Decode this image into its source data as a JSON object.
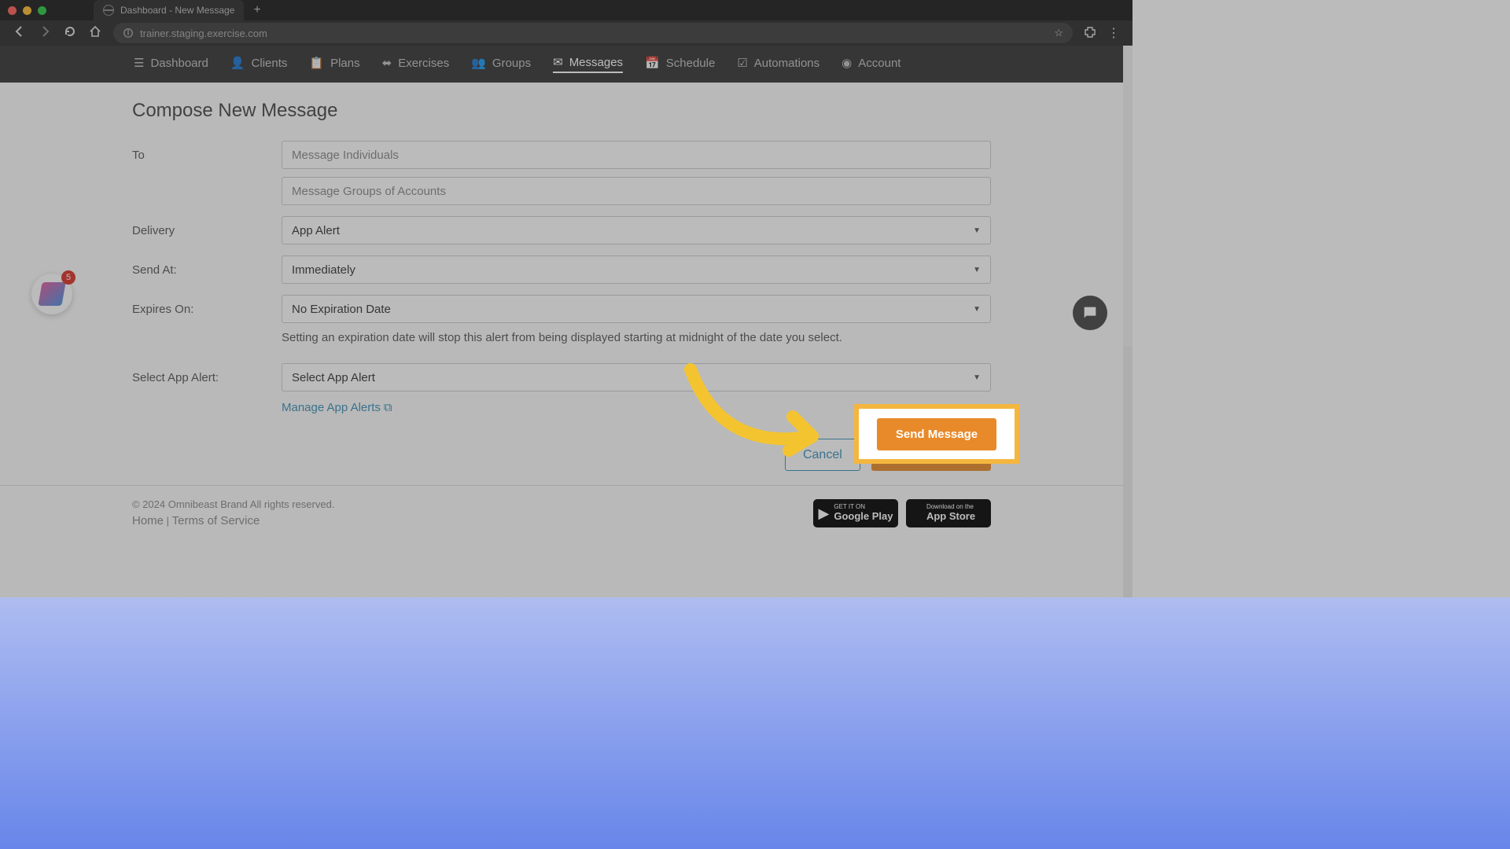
{
  "browser": {
    "tab_title": "Dashboard - New Message",
    "url": "trainer.staging.exercise.com",
    "new_tab": "+",
    "nav": {
      "back": "←",
      "forward": "→",
      "reload": "⟳",
      "home": "⌂",
      "star": "☆",
      "ext": "✦",
      "menu": "⋮"
    }
  },
  "nav": [
    {
      "label": "Dashboard",
      "icon": "menu"
    },
    {
      "label": "Clients",
      "icon": "user"
    },
    {
      "label": "Plans",
      "icon": "clipboard"
    },
    {
      "label": "Exercises",
      "icon": "dumbbell"
    },
    {
      "label": "Groups",
      "icon": "users"
    },
    {
      "label": "Messages",
      "icon": "envelope",
      "active": true
    },
    {
      "label": "Schedule",
      "icon": "calendar"
    },
    {
      "label": "Automations",
      "icon": "check"
    },
    {
      "label": "Account",
      "icon": "account"
    }
  ],
  "page": {
    "title": "Compose New Message",
    "to_label": "To",
    "to_individuals_placeholder": "Message Individuals",
    "to_groups_placeholder": "Message Groups of Accounts",
    "delivery_label": "Delivery",
    "delivery_value": "App Alert",
    "send_at_label": "Send At:",
    "send_at_value": "Immediately",
    "expires_label": "Expires On:",
    "expires_value": "No Expiration Date",
    "expires_help": "Setting an expiration date will stop this alert from being displayed starting at midnight of the date you select.",
    "select_alert_label": "Select App Alert:",
    "select_alert_value": "Select App Alert",
    "manage_link": "Manage App Alerts",
    "cancel": "Cancel",
    "send": "Send Message"
  },
  "footer": {
    "copyright": "© 2024 Omnibeast Brand All rights reserved.",
    "home": "Home",
    "sep": " | ",
    "tos": "Terms of Service",
    "google_top": "GET IT ON",
    "google_bottom": "Google Play",
    "apple_top": "Download on the",
    "apple_bottom": "App Store"
  },
  "floats": {
    "badge_count": "5"
  },
  "highlight": {
    "send": "Send Message"
  }
}
